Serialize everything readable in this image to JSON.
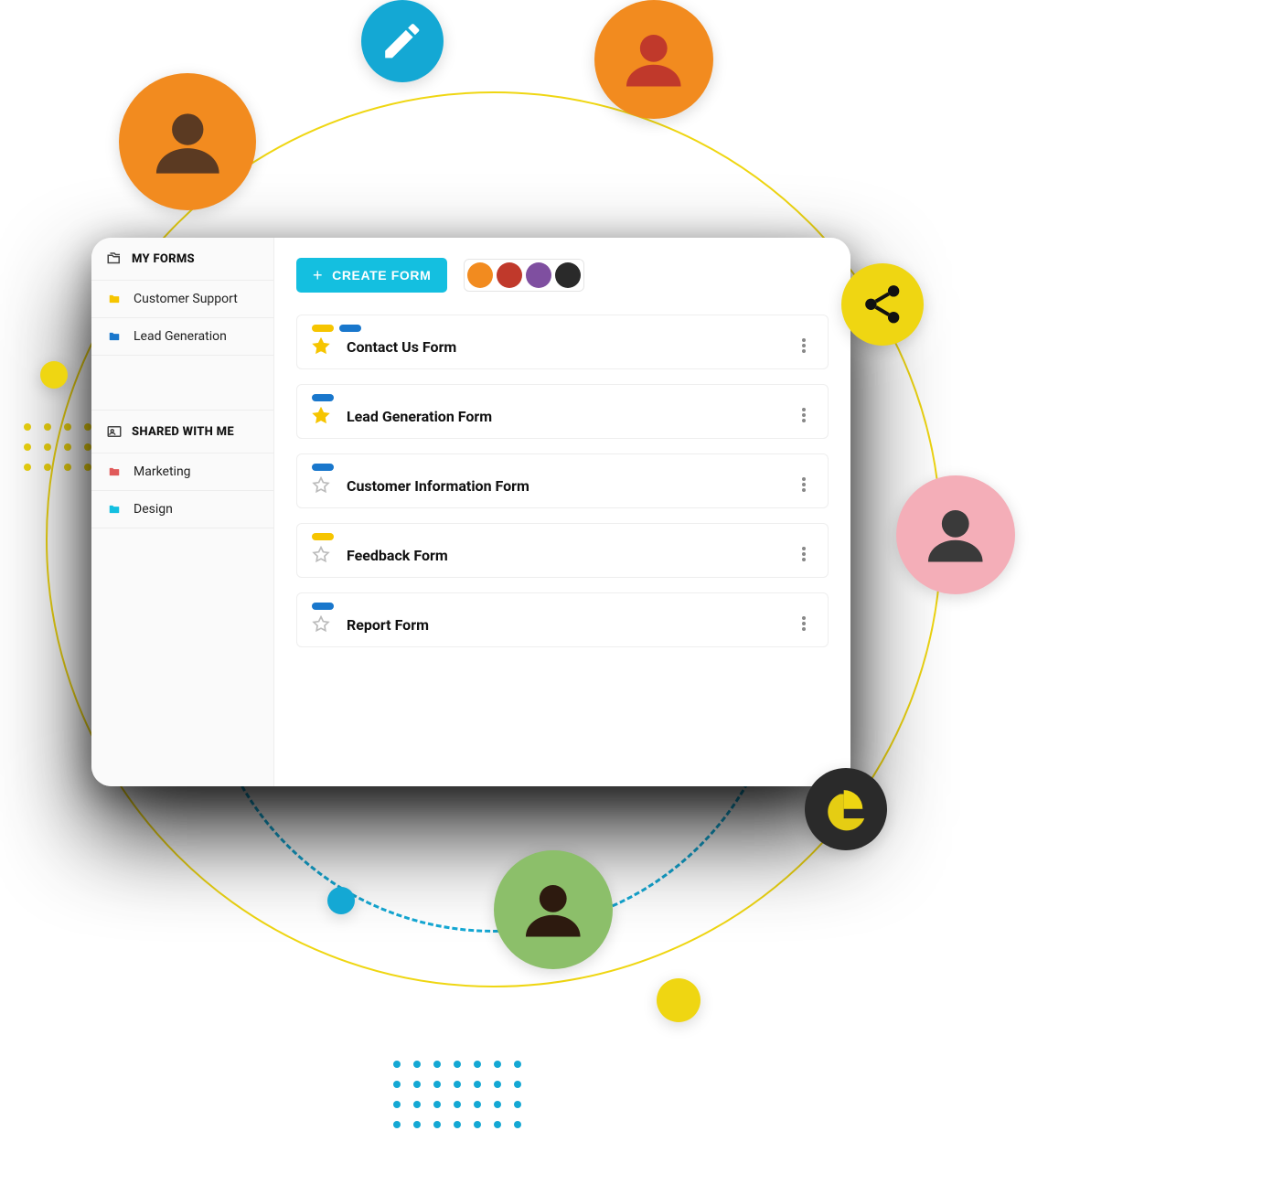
{
  "sidebar": {
    "myFormsHeader": "MY FORMS",
    "sharedHeader": "SHARED WITH ME",
    "myForms": [
      {
        "label": "Customer Support",
        "color": "#f6c500"
      },
      {
        "label": "Lead Generation",
        "color": "#1977cc"
      }
    ],
    "shared": [
      {
        "label": "Marketing",
        "color": "#e05a5a"
      },
      {
        "label": "Design",
        "color": "#14bfe0"
      }
    ]
  },
  "topbar": {
    "createLabel": "CREATE FORM",
    "avatars": [
      "#f28b1f",
      "#c0392b",
      "#7f4fa0",
      "#2a2a2a"
    ]
  },
  "forms": [
    {
      "title": "Contact Us Form",
      "starred": true,
      "tags": [
        "yellow",
        "blue"
      ]
    },
    {
      "title": "Lead Generation Form",
      "starred": true,
      "tags": [
        "blue"
      ]
    },
    {
      "title": "Customer Information Form",
      "starred": false,
      "tags": [
        "blue"
      ]
    },
    {
      "title": "Feedback Form",
      "starred": false,
      "tags": [
        "yellow"
      ]
    },
    {
      "title": "Report Form",
      "starred": false,
      "tags": [
        "blue"
      ]
    }
  ],
  "decor": {
    "editIcon": "pencil-icon",
    "shareIcon": "share-icon",
    "chartIcon": "pie-chart-icon"
  }
}
